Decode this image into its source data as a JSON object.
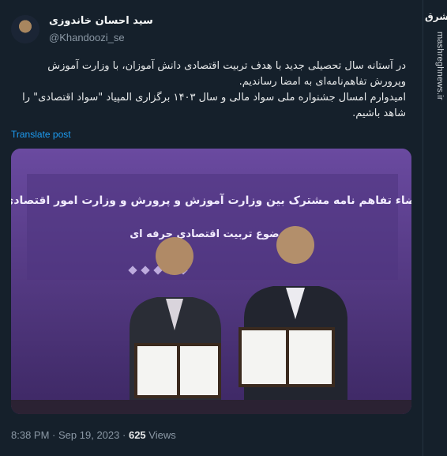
{
  "tweet": {
    "author_name": "سید احسان خاندوزی",
    "author_handle": "@Khandoozi_se",
    "text_line1": "در آستانه سال تحصیلی جدید با هدف تربیت اقتصادی دانش آموزان، با وزارت آموزش وپرورش تفاهم‌نامه‌ای به امضا رساندیم.",
    "text_line2": "امیدوارم امسال جشنواره ملی سواد مالی  و سال ۱۴۰۳ برگزاری المپیاد \"سواد اقتصادی\" را شاهد باشیم.",
    "translate_label": "Translate post",
    "time": "8:38 PM",
    "separator": "·",
    "date": "Sep 19, 2023",
    "views_count": "625",
    "views_label": "Views"
  },
  "photo": {
    "banner_line1": "مراسم امضاء تفاهم نامه مشترک بین وزارت آموزش و پرورش و وزارت امور اقتصادی و دارایی",
    "banner_line2": "موضوع تربیت اقتصادی حرفه ای"
  },
  "watermark": {
    "logo_text": "مشرق",
    "url": "mashreghnews.ir"
  },
  "colors": {
    "background": "#15202b",
    "link": "#1d9bf0",
    "muted": "#8b98a5",
    "banner": "#5c3e8c"
  }
}
